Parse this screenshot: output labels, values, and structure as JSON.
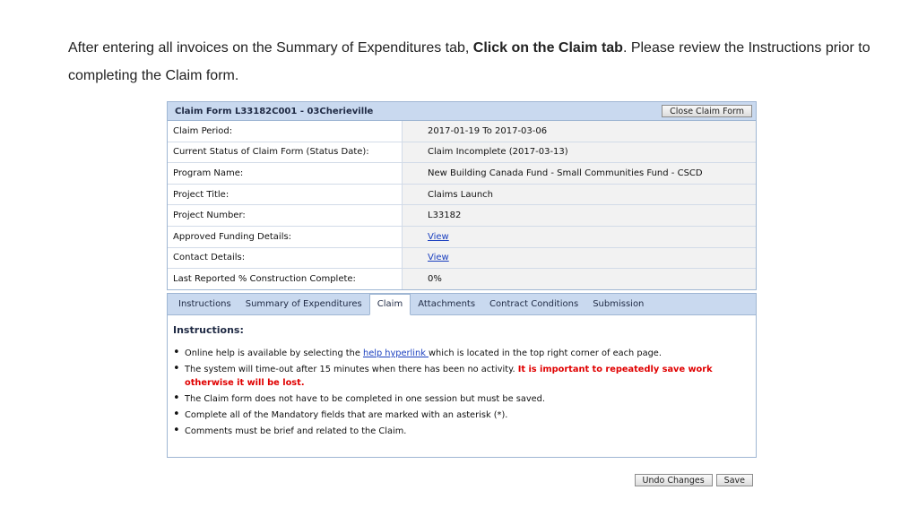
{
  "intro": {
    "part1": "After entering all invoices on the Summary of Expenditures tab, ",
    "bold": "Click on the Claim tab",
    "part2": ".  Please review the Instructions prior to completing the Claim form."
  },
  "form": {
    "title": "Claim Form L33182C001 - 03Cherieville",
    "close_label": "Close Claim Form",
    "rows": [
      {
        "label": "Claim Period:",
        "value": "2017-01-19 To 2017-03-06"
      },
      {
        "label": "Current Status of Claim Form (Status Date):",
        "value": "Claim Incomplete (2017-03-13)"
      },
      {
        "label": "Program Name:",
        "value": "New Building Canada Fund - Small Communities Fund - CSCD"
      },
      {
        "label": "Project Title:",
        "value": "Claims Launch"
      },
      {
        "label": "Project Number:",
        "value": "L33182"
      },
      {
        "label": "Approved Funding Details:",
        "value": "View"
      },
      {
        "label": "Contact Details:",
        "value": "View"
      },
      {
        "label": "Last Reported % Construction Complete:",
        "value": "0%"
      }
    ]
  },
  "tabs": {
    "items": [
      "Instructions",
      "Summary of Expenditures",
      "Claim",
      "Attachments",
      "Contract Conditions",
      "Submission"
    ],
    "active": "Claim"
  },
  "instructions": {
    "title": "Instructions:",
    "b1_pre": "Online help is available by selecting the ",
    "b1_link": "help hyperlink ",
    "b1_post": "which is located in the top right corner of each page.",
    "b2_pre": "The system will time-out after 15 minutes when there has been no activity. ",
    "b2_warn": "It is important to repeatedly save work otherwise it will be lost.",
    "b3": "The Claim form does not have to be completed in one session but must be saved.",
    "b4": "Complete all of the Mandatory fields that are marked with an asterisk (*).",
    "b5": "Comments must be brief and related to the Claim."
  },
  "actions": {
    "undo_label": "Undo Changes",
    "save_label": "Save"
  }
}
